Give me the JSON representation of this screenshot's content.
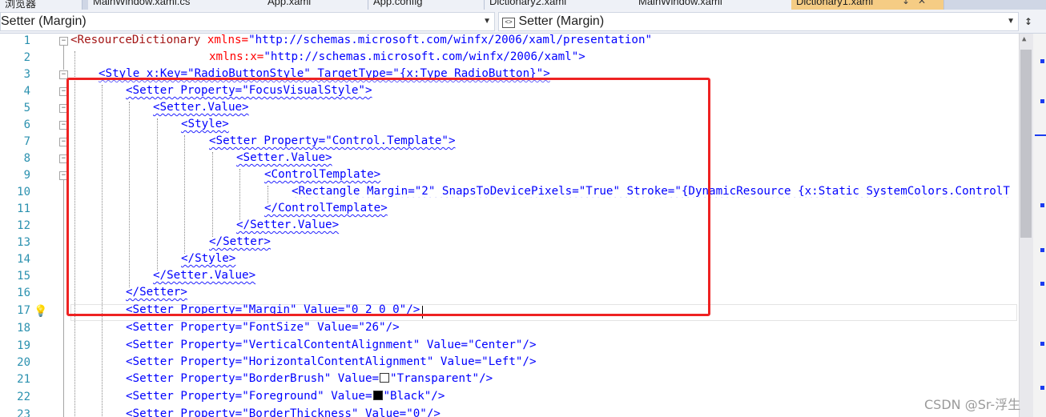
{
  "tabs": [
    {
      "label": "浏览器",
      "active": false
    },
    {
      "label": "MainWindow.xaml.cs",
      "active": false
    },
    {
      "label": "App.xaml",
      "active": false
    },
    {
      "label": "App.config",
      "active": false
    },
    {
      "label": "Dictionary2.xaml",
      "active": false
    },
    {
      "label": "MainWindow.xaml",
      "active": false
    },
    {
      "label": "Dictionary1.xaml",
      "active": true,
      "pin_icon": "pin-icon",
      "close_icon": "close-icon"
    }
  ],
  "navbar": {
    "left_dropdown": "Setter (Margin)",
    "right_dropdown": "Setter (Margin)",
    "right_dropdown_icon": "xaml-element-icon",
    "split_icon": "split-window-icon"
  },
  "editor": {
    "lines": [
      {
        "n": "1"
      },
      {
        "n": "2"
      },
      {
        "n": "3"
      },
      {
        "n": "4"
      },
      {
        "n": "5"
      },
      {
        "n": "6"
      },
      {
        "n": "7"
      },
      {
        "n": "8"
      },
      {
        "n": "9"
      },
      {
        "n": "10"
      },
      {
        "n": "11"
      },
      {
        "n": "12"
      },
      {
        "n": "13"
      },
      {
        "n": "14"
      },
      {
        "n": "15"
      },
      {
        "n": "16"
      },
      {
        "n": "17"
      },
      {
        "n": "18"
      },
      {
        "n": "19"
      },
      {
        "n": "20"
      },
      {
        "n": "21"
      },
      {
        "n": "22"
      },
      {
        "n": "23"
      }
    ],
    "code": {
      "l1_tag": "<ResourceDictionary",
      "l1_attr": " xmlns=",
      "l1_val": "\"http://schemas.microsoft.com/winfx/2006/xaml/presentation\"",
      "l2_attr": "xmlns:x=",
      "l2_val": "\"http://schemas.microsoft.com/winfx/2006/xaml\">",
      "l3": "<Style x:Key=\"RadioButtonStyle\" TargetType=\"{x:Type RadioButton}\">",
      "l4": "<Setter Property=\"FocusVisualStyle\">",
      "l5": "<Setter.Value>",
      "l6": "<Style>",
      "l7": "<Setter Property=\"Control.Template\">",
      "l8": "<Setter.Value>",
      "l9": "<ControlTemplate>",
      "l10": "<Rectangle Margin=\"2\" SnapsToDevicePixels=\"True\" Stroke=\"{DynamicResource {x:Static SystemColors.ControlT",
      "l11": "</ControlTemplate>",
      "l12": "</Setter.Value>",
      "l13": "</Setter>",
      "l14": "</Style>",
      "l15": "</Setter.Value>",
      "l16": "</Setter>",
      "l17": "<Setter Property=\"Margin\" Value=\"0 2 0 0\"/>",
      "l18": "<Setter Property=\"FontSize\" Value=\"26\"/>",
      "l19": "<Setter Property=\"VerticalContentAlignment\" Value=\"Center\"/>",
      "l20": "<Setter Property=\"HorizontalContentAlignment\" Value=\"Left\"/>",
      "l21a": "<Setter Property=\"BorderBrush\" Value=",
      "l21b": "\"Transparent\"/>",
      "l22a": "<Setter Property=\"Foreground\" Value=",
      "l22b": "\"Black\"/>",
      "l23": "<Setter Property=\"BorderThickness\" Value=\"0\"/>"
    },
    "lightbulb_icon": "lightbulb-icon",
    "colors": {
      "highlight_box": "#ee2222",
      "line_number": "#2b91af",
      "tag": "#a31515",
      "attribute": "#ff0000",
      "value": "#0000ff"
    }
  },
  "watermark": "CSDN @Sr-浮生"
}
